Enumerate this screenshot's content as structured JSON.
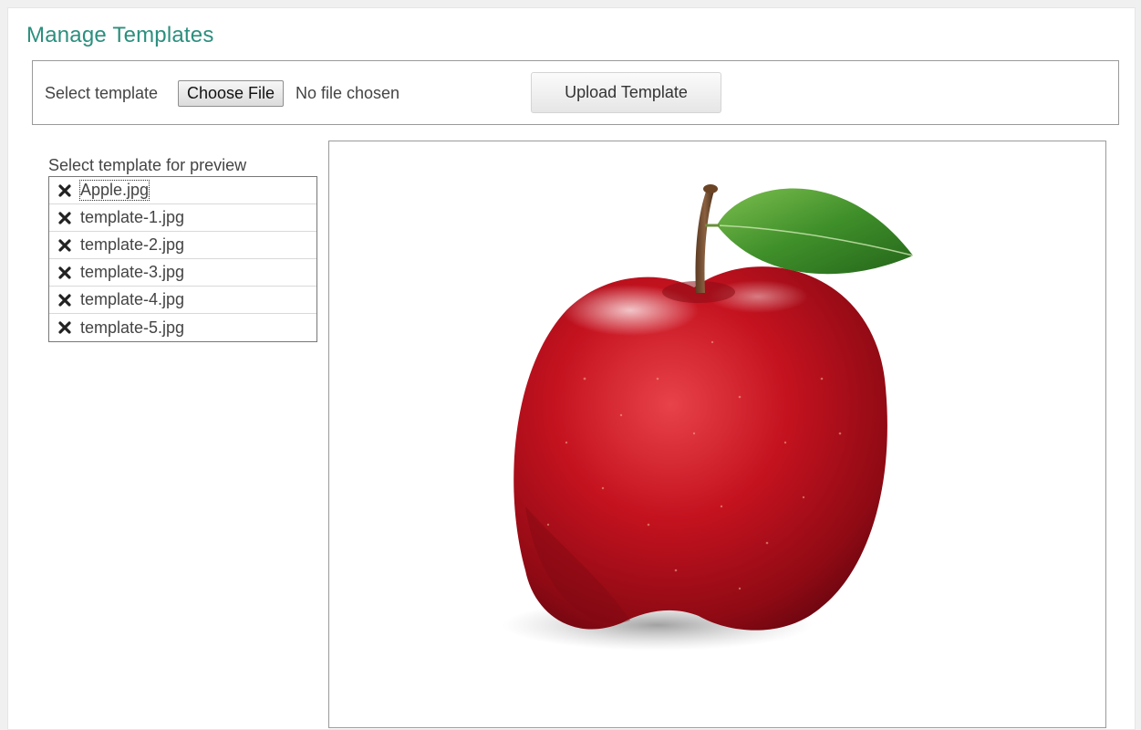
{
  "page": {
    "title": "Manage Templates"
  },
  "upload": {
    "label": "Select template",
    "choose_file_label": "Choose File",
    "no_file_text": "No file chosen",
    "upload_button_label": "Upload Template"
  },
  "templates": {
    "heading": "Select template for preview",
    "items": [
      {
        "name": "Apple.jpg",
        "selected": true
      },
      {
        "name": "template-1.jpg",
        "selected": false
      },
      {
        "name": "template-2.jpg",
        "selected": false
      },
      {
        "name": "template-3.jpg",
        "selected": false
      },
      {
        "name": "template-4.jpg",
        "selected": false
      },
      {
        "name": "template-5.jpg",
        "selected": false
      }
    ],
    "remove_icon": "close-icon"
  },
  "preview": {
    "image_subject": "red apple with leaf"
  },
  "colors": {
    "title": "#2b8f7e",
    "apple_red": "#c4121f",
    "leaf_green": "#3f8f2a"
  }
}
